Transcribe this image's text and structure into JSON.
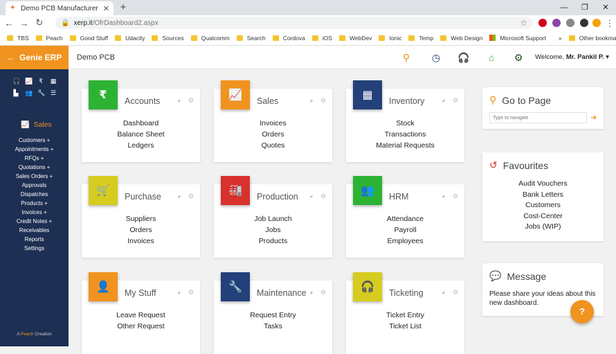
{
  "browser": {
    "tab_title": "Demo PCB Manufacturer",
    "url_host": "xerp.it",
    "url_path": "/OfrDashboard2.aspx",
    "bookmarks": [
      "TBS",
      "Peach",
      "Good Stuff",
      "Udacity",
      "Sources",
      "Qualcomm",
      "Search",
      "Cordova",
      "iOS",
      "WebDev",
      "Ionic",
      "Temp",
      "Web Design",
      "Microsoft Support"
    ],
    "more_bookmarks": "»",
    "other_bookmarks": "Other bookmarks"
  },
  "app": {
    "brand": "Genie ERP",
    "company": "Demo PCB",
    "welcome_prefix": "Welcome,",
    "welcome_user": "Mr. Pankil P.",
    "accent": "#f0931f",
    "sidebar_bg": "#1d2f52"
  },
  "sidebar": {
    "section": "Sales",
    "items": [
      "Customers +",
      "Appointments +",
      "RFQs +",
      "Quotations +",
      "Sales Orders +",
      "Approvals",
      "Dispatches",
      "Products +",
      "Invoices +",
      "Credit Notes +",
      "Receivables",
      "Reports",
      "Settings"
    ],
    "footer_a": "A",
    "footer_peach": "Peach",
    "footer_creation": "Creation"
  },
  "cards": [
    {
      "title": "Accounts",
      "color": "#2db334",
      "icon": "₹",
      "links": [
        "Dashboard",
        "Balance Sheet",
        "Ledgers"
      ]
    },
    {
      "title": "Sales",
      "color": "#f0931f",
      "icon": "📈",
      "links": [
        "Invoices",
        "Orders",
        "Quotes"
      ]
    },
    {
      "title": "Inventory",
      "color": "#23407a",
      "icon": "▦",
      "links": [
        "Stock",
        "Transactions",
        "Material Requests"
      ]
    },
    {
      "title": "Purchase",
      "color": "#d6cc1f",
      "icon": "🛒",
      "links": [
        "Suppliers",
        "Orders",
        "Invoices"
      ]
    },
    {
      "title": "Production",
      "color": "#d9312d",
      "icon": "🏭",
      "links": [
        "Job Launch",
        "Jobs",
        "Products"
      ]
    },
    {
      "title": "HRM",
      "color": "#2db334",
      "icon": "👥",
      "links": [
        "Attendance",
        "Payroll",
        "Employees"
      ]
    },
    {
      "title": "My Stuff",
      "color": "#f0931f",
      "icon": "👤",
      "links": [
        "Leave Request",
        "Other Request"
      ]
    },
    {
      "title": "Maintenance",
      "color": "#23407a",
      "icon": "🔧",
      "links": [
        "Request Entry",
        "Tasks"
      ]
    },
    {
      "title": "Ticketing",
      "color": "#d6cc1f",
      "icon": "🎧",
      "links": [
        "Ticket Entry",
        "Ticket List"
      ]
    }
  ],
  "goto": {
    "title": "Go to Page",
    "placeholder": "Type to navigate"
  },
  "favourites": {
    "title": "Favourites",
    "items": [
      "Audit Vouchers",
      "Bank Letters",
      "Customers",
      "Cost-Center",
      "Jobs (WIP)"
    ]
  },
  "message": {
    "title": "Message",
    "text": "Please share your ideas about this new dashboard."
  },
  "help_label": "?"
}
